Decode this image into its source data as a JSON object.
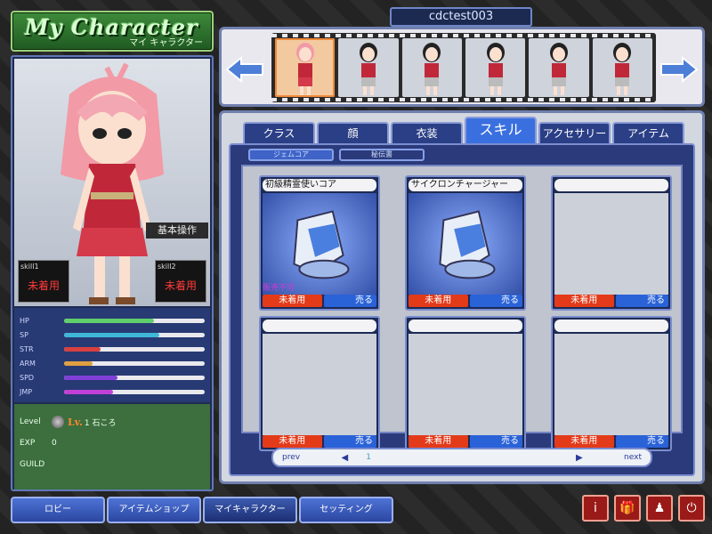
{
  "header": {
    "title": "My Character",
    "subtitle": "マイ キャラクター",
    "username": "cdctest003"
  },
  "character_strip": {
    "slots": 6,
    "selected_index": 0
  },
  "left": {
    "basic_ops_label": "基本操作",
    "skill1": {
      "label": "skill1",
      "value": "未着用"
    },
    "skill2": {
      "label": "skill2",
      "value": "未着用"
    },
    "stats": [
      {
        "label": "HP",
        "value": 0.64,
        "color": "#5fcf6b"
      },
      {
        "label": "SP",
        "value": 0.68,
        "color": "#3fb8d8"
      },
      {
        "label": "STR",
        "value": 0.26,
        "color": "#d84040"
      },
      {
        "label": "ARM",
        "value": 0.2,
        "color": "#e0a040"
      },
      {
        "label": "SPD",
        "value": 0.38,
        "color": "#8040d8"
      },
      {
        "label": "JMP",
        "value": 0.35,
        "color": "#c040d8"
      }
    ],
    "level_label": "Level",
    "level_badge": "Lv.",
    "level_value": "1 石ころ",
    "exp_label": "EXP",
    "exp_value": "0",
    "guild_label": "GUILD"
  },
  "tabs": [
    {
      "label": "クラス"
    },
    {
      "label": "顔"
    },
    {
      "label": "衣装"
    },
    {
      "label": "スキル"
    },
    {
      "label": "アクセサリー"
    },
    {
      "label": "アイテム"
    }
  ],
  "active_tab_index": 3,
  "subtabs": [
    {
      "label": "ジェムコア"
    },
    {
      "label": "秘伝書"
    }
  ],
  "items": [
    {
      "name": "初級精霊使いコア",
      "has_item": true,
      "not_for_sale": "販売不可",
      "unequip": "未着用",
      "sell": "売る"
    },
    {
      "name": "サイクロンチャージャー",
      "has_item": true,
      "not_for_sale": "",
      "unequip": "未着用",
      "sell": "売る"
    },
    {
      "name": "",
      "has_item": false,
      "not_for_sale": "",
      "unequip": "未着用",
      "sell": "売る"
    },
    {
      "name": "",
      "has_item": false,
      "not_for_sale": "",
      "unequip": "未着用",
      "sell": "売る"
    },
    {
      "name": "",
      "has_item": false,
      "not_for_sale": "",
      "unequip": "未着用",
      "sell": "売る"
    },
    {
      "name": "",
      "has_item": false,
      "not_for_sale": "",
      "unequip": "未着用",
      "sell": "売る"
    }
  ],
  "pager": {
    "prev": "prev",
    "page": "1",
    "next": "next"
  },
  "bottom_nav": [
    {
      "label": "ロビー"
    },
    {
      "label": "アイテムショップ"
    },
    {
      "label": "マイキャラクター"
    },
    {
      "label": "セッティング"
    }
  ],
  "bottom_nav_active": 2,
  "icon_buttons": [
    {
      "icon": "info-icon",
      "glyph": "i"
    },
    {
      "icon": "gift-icon",
      "glyph": "🎁"
    },
    {
      "icon": "person-icon",
      "glyph": "♟"
    },
    {
      "icon": "power-icon",
      "glyph": "⏻"
    }
  ]
}
